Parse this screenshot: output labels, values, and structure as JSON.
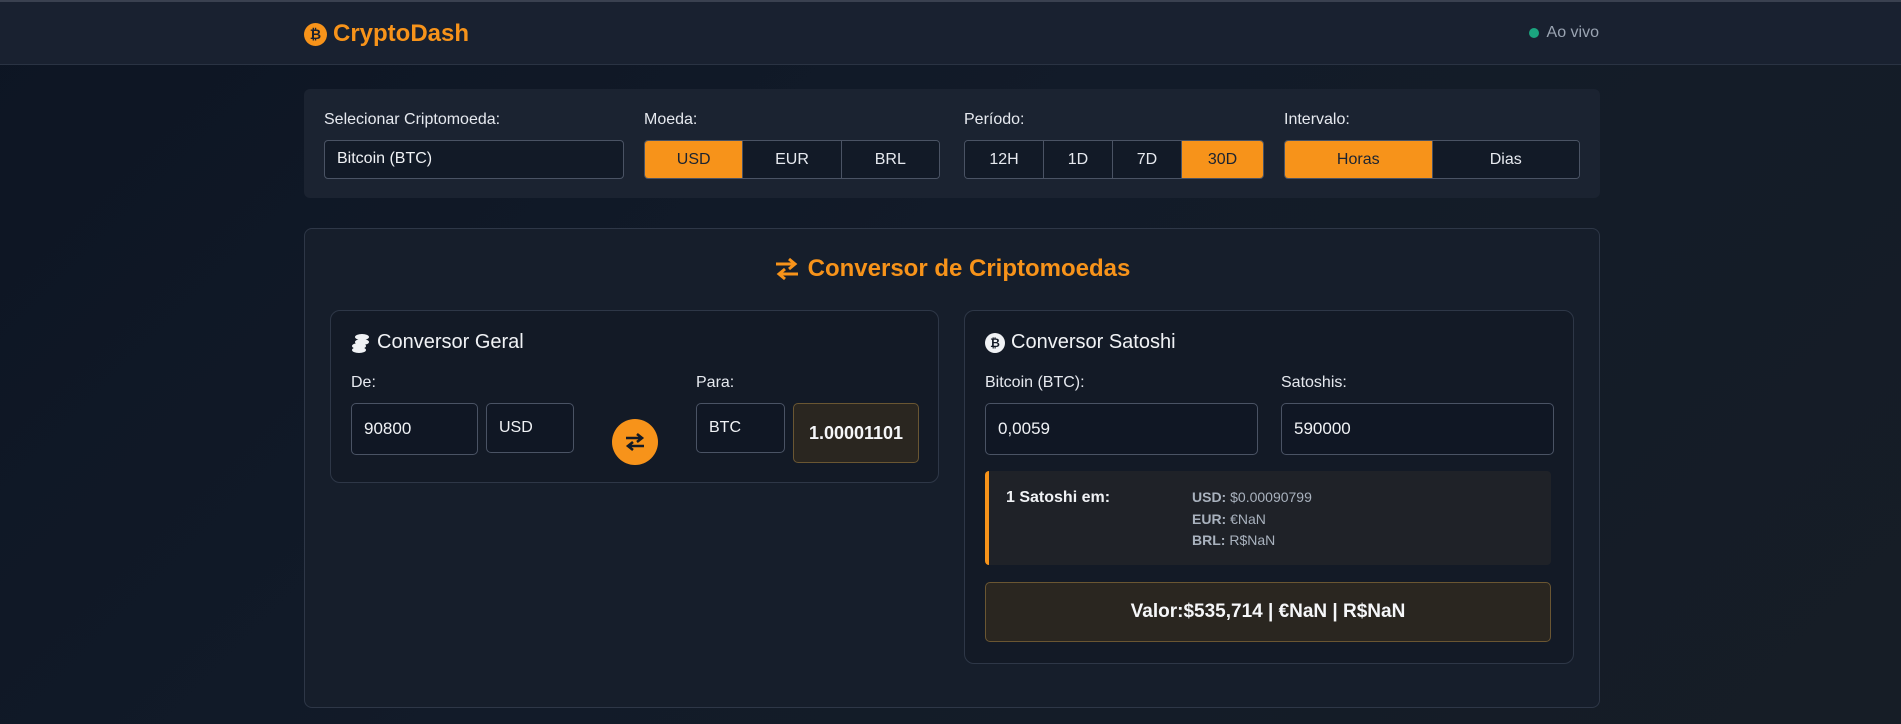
{
  "header": {
    "brand_icon": "₿",
    "brand": "CryptoDash",
    "live_label": "Ao vivo"
  },
  "controls": {
    "crypto": {
      "label": "Selecionar Criptomoeda:",
      "value": "Bitcoin (BTC)"
    },
    "currency": {
      "label": "Moeda:",
      "options": [
        "USD",
        "EUR",
        "BRL"
      ],
      "selected": "USD"
    },
    "period": {
      "label": "Período:",
      "options": [
        "12H",
        "1D",
        "7D",
        "30D"
      ],
      "selected": "30D"
    },
    "interval": {
      "label": "Intervalo:",
      "options": [
        "Horas",
        "Dias"
      ],
      "selected": "Horas"
    }
  },
  "converter": {
    "title": "Conversor de Criptomoedas",
    "general": {
      "title": "Conversor Geral",
      "from_label": "De:",
      "from_amount": "90800",
      "from_currency": "USD",
      "to_label": "Para:",
      "to_currency": "BTC",
      "result": "1.00001101"
    },
    "satoshi": {
      "title": "Conversor Satoshi",
      "btc_label": "Bitcoin (BTC):",
      "btc_value": "0,0059",
      "sats_label": "Satoshis:",
      "sats_value": "590000",
      "info_title": "1 Satoshi em:",
      "rates": [
        {
          "code": "USD:",
          "value": "$0.00090799"
        },
        {
          "code": "EUR:",
          "value": "€NaN"
        },
        {
          "code": "BRL:",
          "value": "R$NaN"
        }
      ],
      "value_line": "Valor:$535,714 | €NaN | R$NaN"
    }
  },
  "colors": {
    "accent": "#f7931a",
    "live": "#1ba57f",
    "background": "#0d1523"
  }
}
